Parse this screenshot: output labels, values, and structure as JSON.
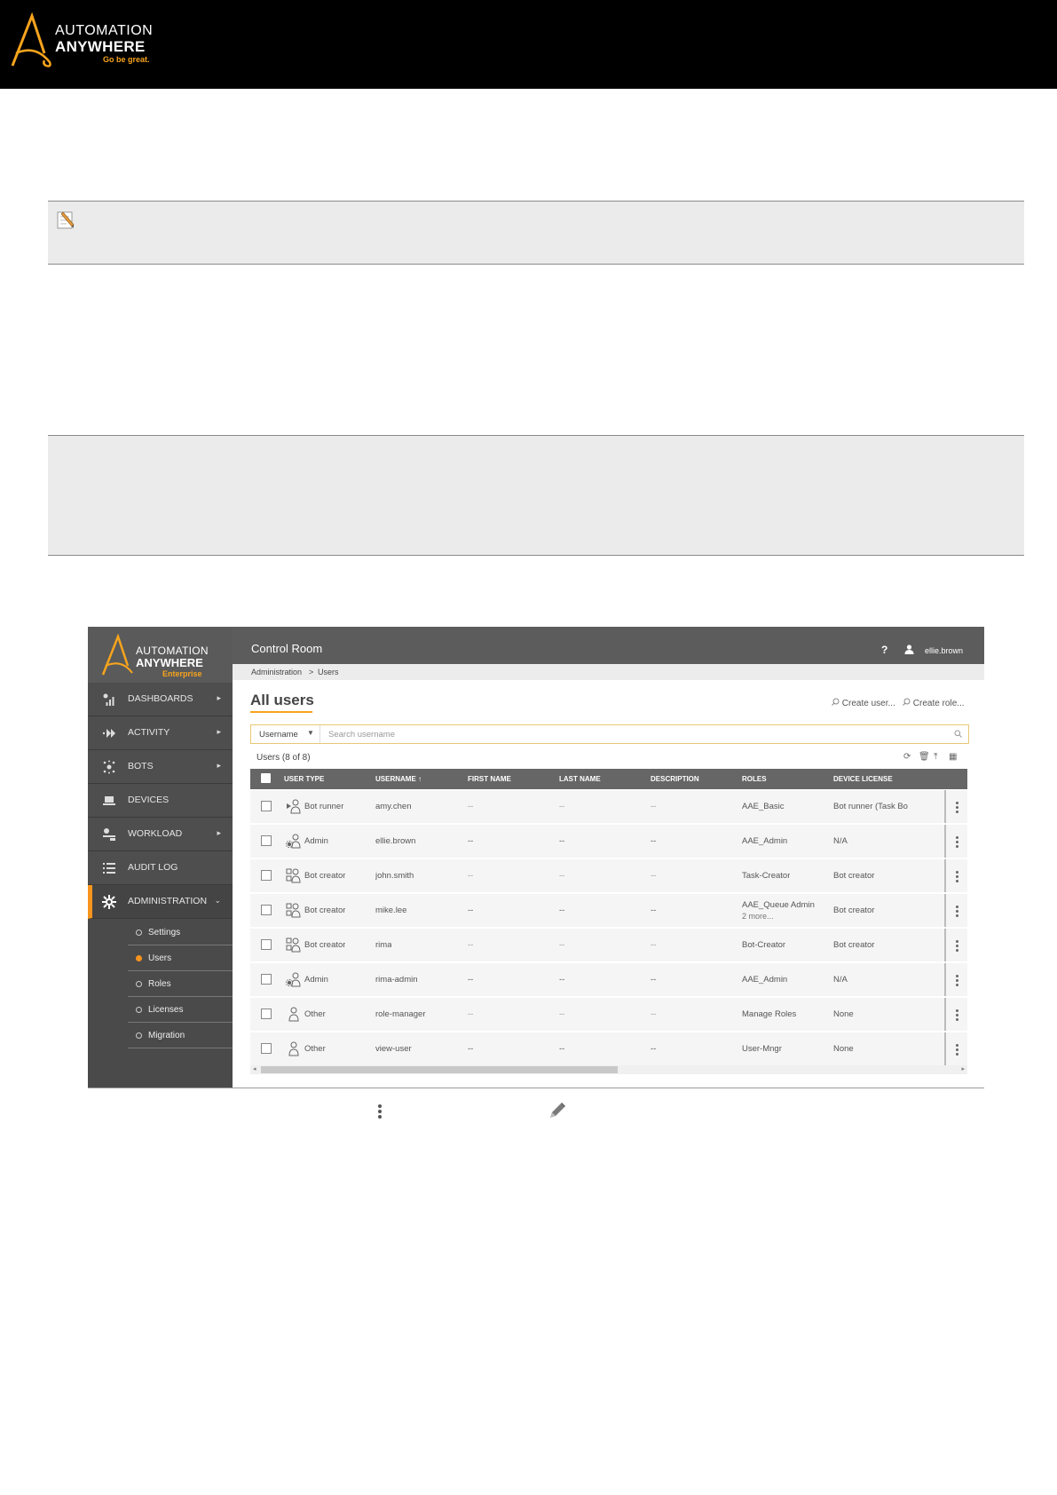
{
  "doc_header": {
    "logo_line1": "AUTOMATION",
    "logo_line2": "ANYWHERE",
    "logo_tagline": "Go be great.",
    "accent_color": "#f7a41d"
  },
  "note_icon": "pencil-note-icon",
  "screenshot": {
    "sidebar": {
      "logo_line1": "AUTOMATION",
      "logo_line2": "ANYWHERE",
      "logo_line3": "Enterprise",
      "nav": [
        {
          "label": "DASHBOARDS",
          "icon": "dashboard-icon",
          "arrow": "▸"
        },
        {
          "label": "ACTIVITY",
          "icon": "activity-icon",
          "arrow": "▸"
        },
        {
          "label": "BOTS",
          "icon": "bots-icon",
          "arrow": "▸"
        },
        {
          "label": "DEVICES",
          "icon": "devices-icon",
          "arrow": ""
        },
        {
          "label": "WORKLOAD",
          "icon": "workload-icon",
          "arrow": "▸"
        },
        {
          "label": "AUDIT LOG",
          "icon": "audit-log-icon",
          "arrow": ""
        },
        {
          "label": "ADMINISTRATION",
          "icon": "administration-icon",
          "arrow": "⌄"
        }
      ],
      "sub": [
        {
          "label": "Settings"
        },
        {
          "label": "Users",
          "selected": true
        },
        {
          "label": "Roles"
        },
        {
          "label": "Licenses"
        },
        {
          "label": "Migration"
        }
      ]
    },
    "topbar": {
      "title": "Control Room",
      "help": "?",
      "username": "ellie.brown"
    },
    "breadcrumb": {
      "parent": "Administration",
      "sep": ">",
      "current": "Users"
    },
    "page_title": "All users",
    "create_user": "Create user...",
    "create_role": "Create role...",
    "search": {
      "field": "Username",
      "placeholder": "Search username"
    },
    "users_count": "Users  (8 of 8)",
    "columns": [
      "USER TYPE",
      "USERNAME ↑",
      "FIRST NAME",
      "LAST NAME",
      "DESCRIPTION",
      "ROLES",
      "DEVICE LICENSE"
    ],
    "rows": [
      {
        "type": "Bot runner",
        "icon": "bot-runner-icon",
        "username": "amy.chen",
        "first": "--",
        "last": "--",
        "desc": "--",
        "roles": "AAE_Basic",
        "roles_more": "",
        "license": "Bot runner (Task Bo"
      },
      {
        "type": "Admin",
        "icon": "admin-user-icon",
        "username": "ellie.brown",
        "first": "--",
        "last": "--",
        "desc": "--",
        "roles": "AAE_Admin",
        "roles_more": "",
        "license": "N/A"
      },
      {
        "type": "Bot creator",
        "icon": "bot-creator-icon",
        "username": "john.smith",
        "first": "--",
        "last": "--",
        "desc": "--",
        "roles": "Task-Creator",
        "roles_more": "",
        "license": "Bot creator"
      },
      {
        "type": "Bot creator",
        "icon": "bot-creator-icon",
        "username": "mike.lee",
        "first": "--",
        "last": "--",
        "desc": "--",
        "roles": "AAE_Queue Admin",
        "roles_more": "2 more...",
        "license": "Bot creator"
      },
      {
        "type": "Bot creator",
        "icon": "bot-creator-icon",
        "username": "rima",
        "first": "--",
        "last": "--",
        "desc": "--",
        "roles": "Bot-Creator",
        "roles_more": "",
        "license": "Bot creator"
      },
      {
        "type": "Admin",
        "icon": "admin-user-icon",
        "username": "rima-admin",
        "first": "--",
        "last": "--",
        "desc": "--",
        "roles": "AAE_Admin",
        "roles_more": "",
        "license": "N/A"
      },
      {
        "type": "Other",
        "icon": "other-user-icon",
        "username": "role-manager",
        "first": "--",
        "last": "--",
        "desc": "--",
        "roles": "Manage Roles",
        "roles_more": "",
        "license": "None"
      },
      {
        "type": "Other",
        "icon": "other-user-icon",
        "username": "view-user",
        "first": "--",
        "last": "--",
        "desc": "--",
        "roles": "User-Mngr",
        "roles_more": "",
        "license": "None"
      }
    ]
  },
  "inline_icons": [
    "kebab-menu-icon",
    "pencil-edit-icon"
  ]
}
